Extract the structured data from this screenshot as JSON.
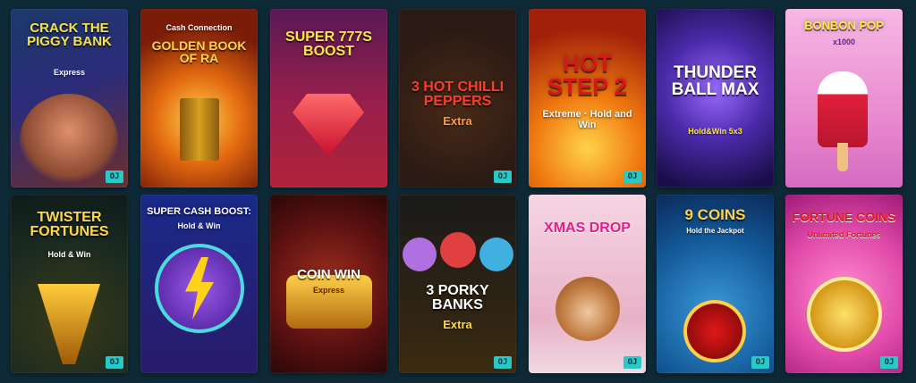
{
  "colors": {
    "page_bg": "#0f2a37",
    "provider_badge_bg": "#2bc8c8",
    "provider_badge_fg": "#06323a"
  },
  "games": [
    {
      "title": "Crack the Piggy Bank",
      "subtitle": "Express",
      "provider": "OJ"
    },
    {
      "title": "Golden Book of Ra",
      "subtitle": "Cash Connection",
      "provider": ""
    },
    {
      "title": "Super 777s Boost",
      "subtitle": "",
      "provider": ""
    },
    {
      "title": "3 Hot Chilli Peppers",
      "subtitle": "Extra",
      "provider": "OJ"
    },
    {
      "title": "Hot Step 2",
      "subtitle": "Extreme · Hold and Win",
      "provider": "OJ"
    },
    {
      "title": "Thunder Ball Max",
      "subtitle": "Hold&Win 5x3",
      "provider": ""
    },
    {
      "title": "Bonbon Pop",
      "subtitle": "x1000",
      "provider": ""
    },
    {
      "title": "Twister Fortunes",
      "subtitle": "Hold & Win",
      "provider": "OJ"
    },
    {
      "title": "Super Cash Boost:",
      "subtitle": "Hold & Win",
      "provider": ""
    },
    {
      "title": "Coin Win",
      "subtitle": "Express",
      "provider": ""
    },
    {
      "title": "3 Porky Banks",
      "subtitle": "Extra",
      "provider": "OJ"
    },
    {
      "title": "Xmas Drop",
      "subtitle": "",
      "provider": "OJ"
    },
    {
      "title": "9 Coins",
      "subtitle": "Hold the Jackpot",
      "provider": "OJ"
    },
    {
      "title": "Fortune Coins",
      "subtitle": "Unlimited Fortunes",
      "provider": "OJ"
    }
  ]
}
